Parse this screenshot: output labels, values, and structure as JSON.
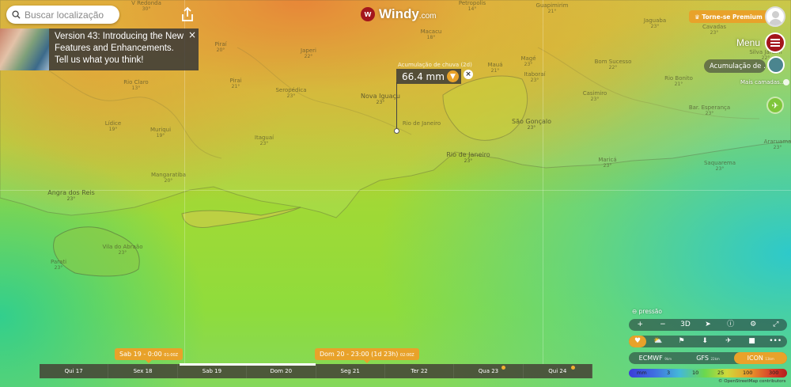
{
  "search": {
    "placeholder": "Buscar localização"
  },
  "brand": {
    "mark": "w",
    "name": "Windy",
    "suffix": ".com"
  },
  "premium": {
    "label": "♛ Torne-se Premium"
  },
  "menu": {
    "label": "Menu"
  },
  "layer": {
    "current": "Acumulação de ...",
    "more": "Mais camadas..."
  },
  "notice": {
    "text": "Version 43: Introducing the New Features and Enhancements. Tell us what you think!",
    "close": "×"
  },
  "picker": {
    "value": "66.4 mm",
    "caption": "Acumulação de chuva (2d)",
    "location": "Rio de Janeiro"
  },
  "places": [
    {
      "name": "V Redonda",
      "t": "30°"
    },
    {
      "name": "Petropolis",
      "t": "14°"
    },
    {
      "name": "Guapimirim",
      "t": "21°"
    },
    {
      "name": "Jaguaba",
      "t": "23°"
    },
    {
      "name": "Cavadas",
      "t": "23°"
    },
    {
      "name": "Piraí",
      "t": "20°"
    },
    {
      "name": "Japeri",
      "t": "22°"
    },
    {
      "name": "Macacu",
      "t": "18°"
    },
    {
      "name": "Silva Jardim",
      "t": "22°"
    },
    {
      "name": "Rio Claro",
      "t": "13°"
    },
    {
      "name": "Mauá",
      "t": "21°"
    },
    {
      "name": "Magé",
      "t": "23°"
    },
    {
      "name": "Bom Sucesso",
      "t": "22°"
    },
    {
      "name": "Rio Bonito",
      "t": "21°"
    },
    {
      "name": "Casimiro",
      "t": "23°"
    },
    {
      "name": "Mangaratiba",
      "t": "20°"
    },
    {
      "name": "Seropédica",
      "t": "23°"
    },
    {
      "name": "Nova Iguaçu",
      "t": "23°"
    },
    {
      "name": "Itaboraí",
      "t": "23°"
    },
    {
      "name": "Bar. Esperança",
      "t": "23°"
    },
    {
      "name": "Lídice",
      "t": "19°"
    },
    {
      "name": "Muriqui",
      "t": "19°"
    },
    {
      "name": "Itaguaí",
      "t": "23°"
    },
    {
      "name": "São Gonçalo",
      "t": "23°"
    },
    {
      "name": "Rio de Janeiro",
      "t": "23°"
    },
    {
      "name": "Maricá",
      "t": "23°"
    },
    {
      "name": "Saquarema",
      "t": "23°"
    },
    {
      "name": "Araruama",
      "t": "23°"
    },
    {
      "name": "Angra dos Reis",
      "t": "23°"
    },
    {
      "name": "Vila do Abraão",
      "t": "23°"
    },
    {
      "name": "Parati",
      "t": "23°"
    },
    {
      "name": "Pirai",
      "t": "21°"
    }
  ],
  "overlay": {
    "pressure": "pressão"
  },
  "toolbar1": [
    "+",
    "−",
    "3D",
    "➤",
    "ⓘ",
    "⚙",
    "⤢"
  ],
  "toolbar2": [
    "♥",
    "⛅",
    "⚑",
    "⬇",
    "✈",
    "■",
    "•••"
  ],
  "models": [
    {
      "name": "ECMWF",
      "res": "9km"
    },
    {
      "name": "GFS",
      "res": "22km"
    },
    {
      "name": "ICON",
      "res": "13km"
    }
  ],
  "legend": {
    "unit": "mm",
    "ticks": [
      "3",
      "10",
      "25",
      "100",
      "300"
    ]
  },
  "attribution": "© OpenStreetMap contributors",
  "timeline": {
    "days": [
      "Qui 17",
      "Sex 18",
      "Sab 19",
      "Dom 20",
      "Seg 21",
      "Ter 22",
      "Qua 23",
      "Qui 24"
    ],
    "bubble_left": {
      "label": "Sab 19 - 0:00",
      "suffix": "01:00Z"
    },
    "bubble_right": {
      "label": "Dom 20 - 23:00 (1d 23h)",
      "suffix": "02:00Z"
    }
  },
  "colors": {
    "accent": "#e8a22a",
    "brand": "#a3161c"
  }
}
